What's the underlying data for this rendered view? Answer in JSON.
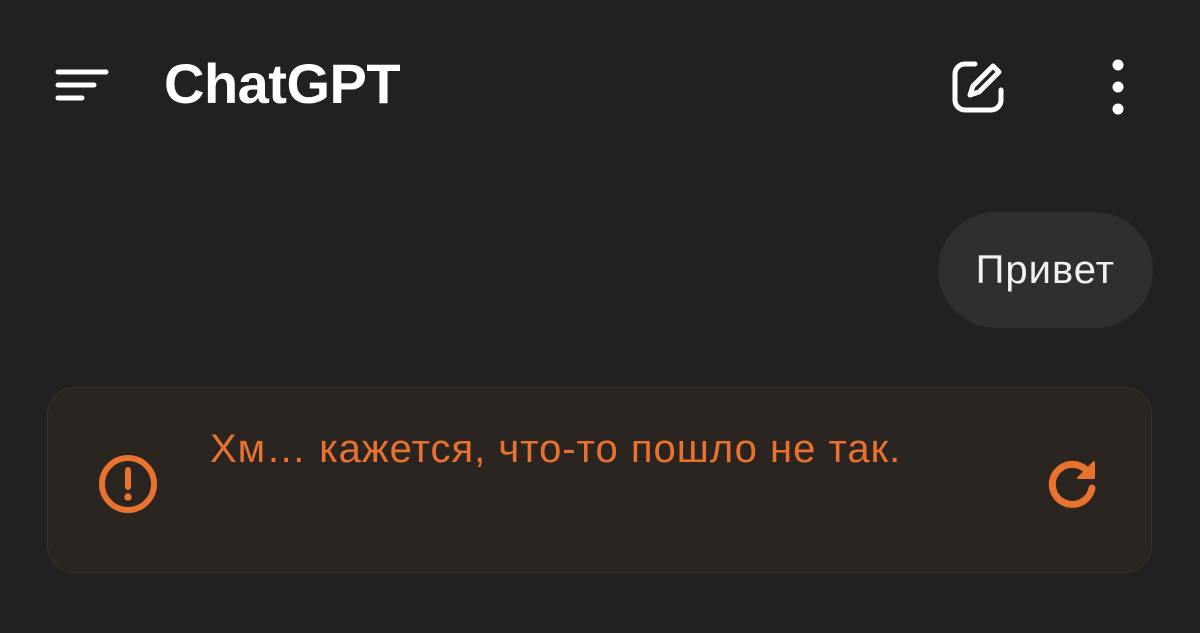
{
  "header": {
    "title": "ChatGPT",
    "menu_icon": "menu-icon",
    "new_chat_icon": "edit-icon",
    "more_icon": "more-vertical-icon"
  },
  "conversation": {
    "user_message": "Привет",
    "error": {
      "icon": "alert-circle-icon",
      "text": "Хм… кажется, что-то пошло не так.",
      "retry_icon": "refresh-icon"
    }
  },
  "colors": {
    "background": "#212121",
    "bubble": "#2f2f2f",
    "error_accent": "#e8722e",
    "error_card": "#2a2521"
  }
}
